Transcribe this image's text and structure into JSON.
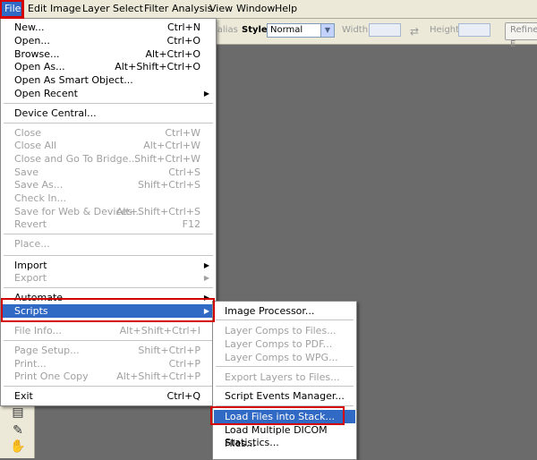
{
  "menubar": [
    "File",
    "Edit",
    "Image",
    "Layer",
    "Select",
    "Filter",
    "Analysis",
    "View",
    "Window",
    "Help"
  ],
  "options": {
    "antialias_fragment": "ialias",
    "style_label": "Style:",
    "style_value": "Normal",
    "width_label": "Width:",
    "height_label": "Height:",
    "refine_label": "Refine E"
  },
  "file_menu": [
    {
      "label": "New...",
      "shortcut": "Ctrl+N",
      "enabled": true
    },
    {
      "label": "Open...",
      "shortcut": "Ctrl+O",
      "enabled": true
    },
    {
      "label": "Browse...",
      "shortcut": "Alt+Ctrl+O",
      "enabled": true
    },
    {
      "label": "Open As...",
      "shortcut": "Alt+Shift+Ctrl+O",
      "enabled": true
    },
    {
      "label": "Open As Smart Object...",
      "shortcut": "",
      "enabled": true
    },
    {
      "label": "Open Recent",
      "shortcut": "",
      "enabled": true,
      "submenu": true
    },
    {
      "separator": true
    },
    {
      "label": "Device Central...",
      "shortcut": "",
      "enabled": true
    },
    {
      "separator": true
    },
    {
      "label": "Close",
      "shortcut": "Ctrl+W",
      "enabled": false
    },
    {
      "label": "Close All",
      "shortcut": "Alt+Ctrl+W",
      "enabled": false
    },
    {
      "label": "Close and Go To Bridge...",
      "shortcut": "Shift+Ctrl+W",
      "enabled": false
    },
    {
      "label": "Save",
      "shortcut": "Ctrl+S",
      "enabled": false
    },
    {
      "label": "Save As...",
      "shortcut": "Shift+Ctrl+S",
      "enabled": false
    },
    {
      "label": "Check In...",
      "shortcut": "",
      "enabled": false
    },
    {
      "label": "Save for Web & Devices...",
      "shortcut": "Alt+Shift+Ctrl+S",
      "enabled": false
    },
    {
      "label": "Revert",
      "shortcut": "F12",
      "enabled": false
    },
    {
      "separator": true
    },
    {
      "label": "Place...",
      "shortcut": "",
      "enabled": false
    },
    {
      "separator": true
    },
    {
      "label": "Import",
      "shortcut": "",
      "enabled": true,
      "submenu": true
    },
    {
      "label": "Export",
      "shortcut": "",
      "enabled": false,
      "submenu": true
    },
    {
      "separator": true
    },
    {
      "label": "Automate",
      "shortcut": "",
      "enabled": true,
      "submenu": true
    },
    {
      "label": "Scripts",
      "shortcut": "",
      "enabled": true,
      "submenu": true,
      "highlighted": true
    },
    {
      "separator": true
    },
    {
      "label": "File Info...",
      "shortcut": "Alt+Shift+Ctrl+I",
      "enabled": false
    },
    {
      "separator": true
    },
    {
      "label": "Page Setup...",
      "shortcut": "Shift+Ctrl+P",
      "enabled": false
    },
    {
      "label": "Print...",
      "shortcut": "Ctrl+P",
      "enabled": false
    },
    {
      "label": "Print One Copy",
      "shortcut": "Alt+Shift+Ctrl+P",
      "enabled": false
    },
    {
      "separator": true
    },
    {
      "label": "Exit",
      "shortcut": "Ctrl+Q",
      "enabled": true
    }
  ],
  "scripts_menu": [
    {
      "label": "Image Processor...",
      "enabled": true
    },
    {
      "separator": true
    },
    {
      "label": "Layer Comps to Files...",
      "enabled": false
    },
    {
      "label": "Layer Comps to PDF...",
      "enabled": false
    },
    {
      "label": "Layer Comps to WPG...",
      "enabled": false
    },
    {
      "separator": true
    },
    {
      "label": "Export Layers to Files...",
      "enabled": false
    },
    {
      "separator": true
    },
    {
      "label": "Script Events Manager...",
      "enabled": true
    },
    {
      "separator": true
    },
    {
      "label": "Load Files into Stack...",
      "enabled": true,
      "highlighted": true
    },
    {
      "label": "Load Multiple DICOM Files...",
      "enabled": true
    },
    {
      "label": "Statistics...",
      "enabled": true
    }
  ],
  "accent": "#316ac5",
  "annotation_color": "#d40000"
}
